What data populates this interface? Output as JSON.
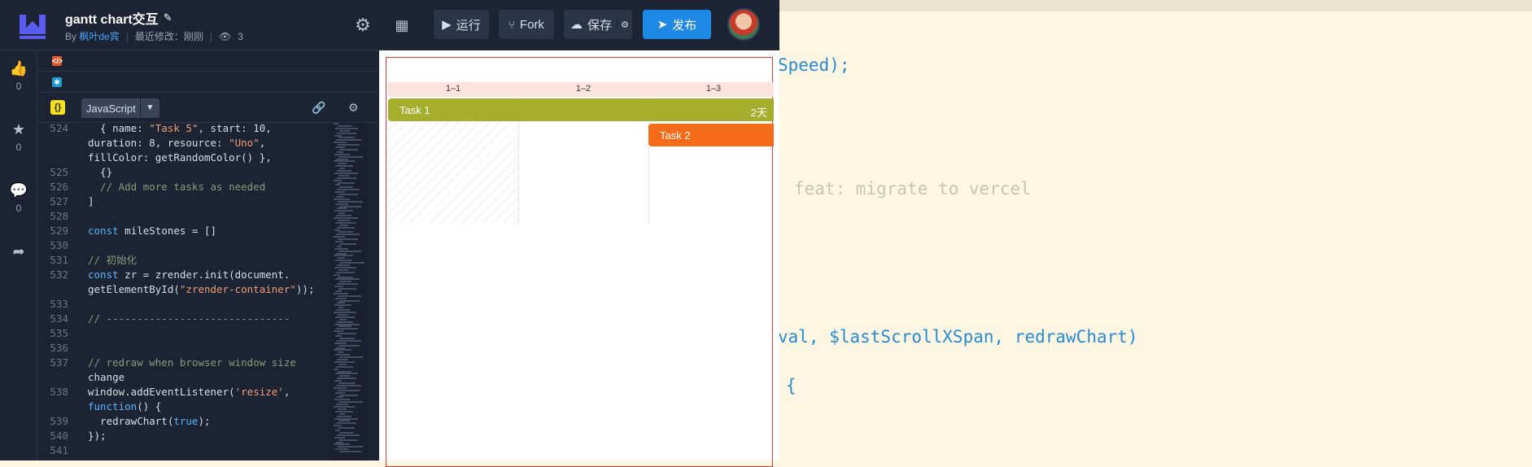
{
  "header": {
    "title": "gantt chart交互",
    "author_prefix": "By",
    "author": "枫叶de宾",
    "modified": "最近修改：刚刚",
    "views": "3",
    "run_label": "运行",
    "fork_label": "Fork",
    "save_label": "保存",
    "publish_label": "发布"
  },
  "rail": {
    "likes": "0",
    "stars": "0",
    "comments": "0"
  },
  "js_panel": {
    "badge": "{}",
    "language": "JavaScript"
  },
  "code_lines": [
    {
      "num": "524",
      "text": "  { name: \"Task 5\", start: 10,"
    },
    {
      "num": "",
      "text": "duration: 8, resource: \"Uno\","
    },
    {
      "num": "",
      "text": "fillColor: getRandomColor() },"
    },
    {
      "num": "525",
      "text": "  {}"
    },
    {
      "num": "526",
      "text": "  // Add more tasks as needed"
    },
    {
      "num": "527",
      "text": "]"
    },
    {
      "num": "528",
      "text": ""
    },
    {
      "num": "529",
      "text": "const mileStones = []"
    },
    {
      "num": "530",
      "text": ""
    },
    {
      "num": "531",
      "text": "// 初始化"
    },
    {
      "num": "532",
      "text": "const zr = zrender.init(document."
    },
    {
      "num": "",
      "text": "getElementById(\"zrender-container\"));"
    },
    {
      "num": "533",
      "text": ""
    },
    {
      "num": "534",
      "text": "// ------------------------------"
    },
    {
      "num": "535",
      "text": ""
    },
    {
      "num": "536",
      "text": ""
    },
    {
      "num": "537",
      "text": "// redraw when browser window size"
    },
    {
      "num": "",
      "text": "change"
    },
    {
      "num": "538",
      "text": "window.addEventListener('resize',"
    },
    {
      "num": "",
      "text": "function() {"
    },
    {
      "num": "539",
      "text": "  redrawChart(true);"
    },
    {
      "num": "540",
      "text": "});"
    },
    {
      "num": "541",
      "text": ""
    }
  ],
  "gantt": {
    "columns": [
      "1–1",
      "1–2",
      "1–3"
    ],
    "task1_name": "Task 1",
    "task1_duration": "2天",
    "task2_name": "Task 2"
  },
  "background_editor": {
    "line1": "Speed);",
    "line2": "feat: migrate to vercel",
    "line3_a": "val, ",
    "line3_b": "$lastScrollXSpan",
    "line3_c": ", ",
    "line3_d": "redrawChart",
    "line3_e": ")",
    "line4": "{"
  }
}
